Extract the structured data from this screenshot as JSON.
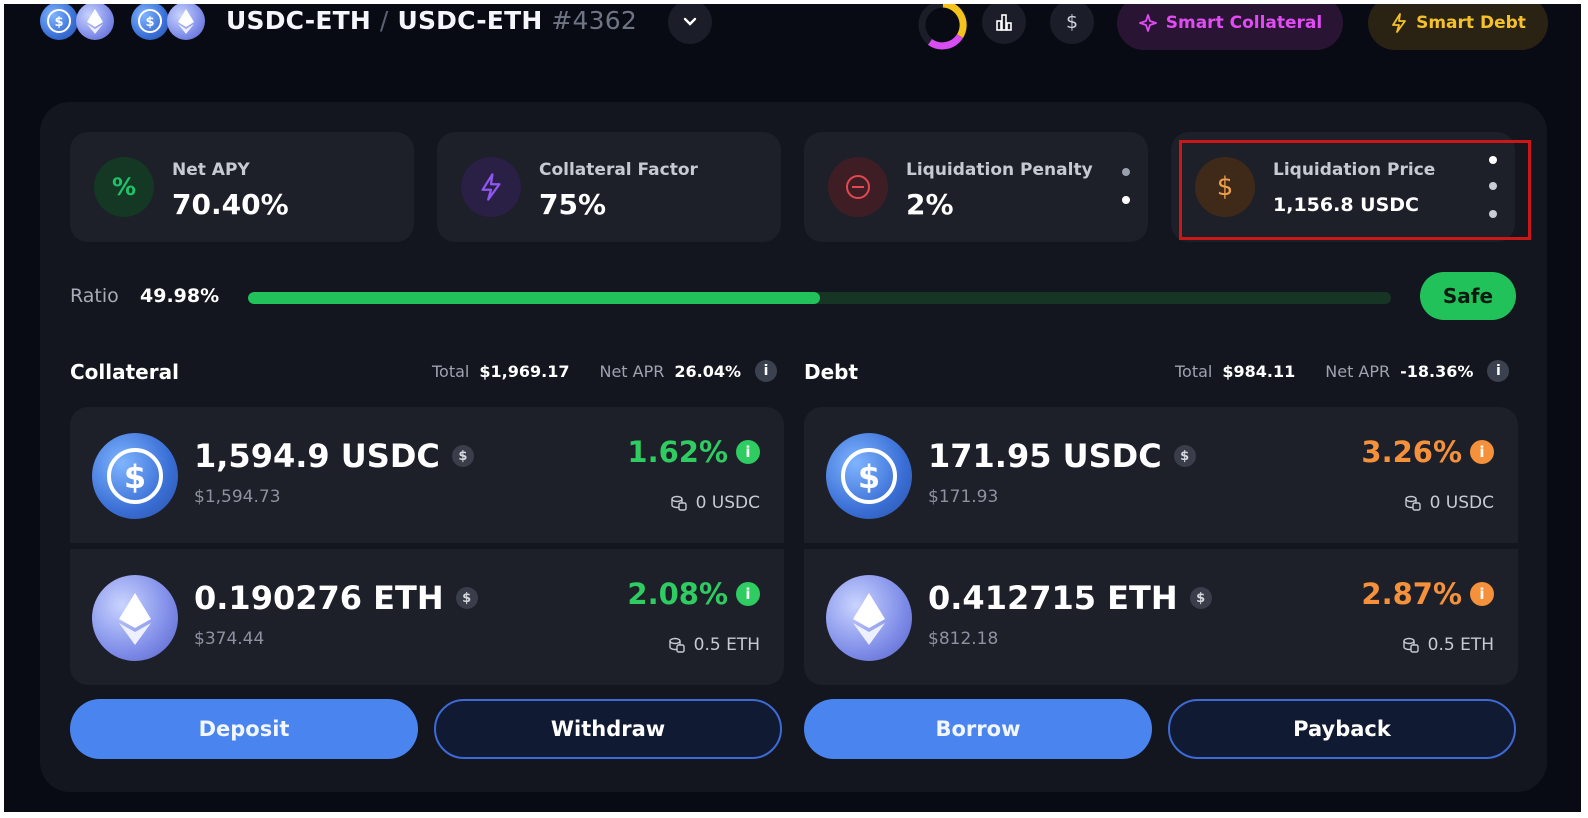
{
  "header": {
    "pair_left": "USDC-ETH",
    "separator": "/",
    "pair_right": "USDC-ETH",
    "position_id": "#4362",
    "icons": [
      "usdc-icon",
      "eth-icon",
      "chevron-down-icon",
      "ring-chart-icon",
      "bar-chart-icon",
      "dollar-icon",
      "sparkle-icon",
      "bolt-icon"
    ],
    "dollar_symbol": "$",
    "smart_collateral_label": "Smart Collateral",
    "smart_debt_label": "Smart Debt"
  },
  "stats": [
    {
      "label": "Net APY",
      "value": "70.40%",
      "icon": "percent-icon",
      "color": "#1ec26a"
    },
    {
      "label": "Collateral Factor",
      "value": "75%",
      "icon": "bolt-icon",
      "color": "#8f57f0"
    },
    {
      "label": "Liquidation Penalty",
      "value": "2%",
      "icon": "minus-circle-icon",
      "color": "#e3494f"
    },
    {
      "label": "Liquidation Price",
      "value": "1,156.8 USDC",
      "icon": "dollar-icon",
      "color": "#f0a04a"
    }
  ],
  "stat_glyphs": {
    "percent": "%",
    "dollar": "$"
  },
  "ratio": {
    "label": "Ratio",
    "value": "49.98%",
    "fill_fraction": 0.5,
    "status": "Safe"
  },
  "collateral": {
    "title": "Collateral",
    "total_label": "Total",
    "total": "$1,969.17",
    "apr_label": "Net APR",
    "apr": "26.04%",
    "assets": [
      {
        "amount": "1,594.9 USDC",
        "usd": "$1,594.73",
        "rate": "1.62%",
        "balance": "0 USDC",
        "coin": "usdc"
      },
      {
        "amount": "0.190276 ETH",
        "usd": "$374.44",
        "rate": "2.08%",
        "balance": "0.5 ETH",
        "coin": "eth"
      }
    ]
  },
  "debt": {
    "title": "Debt",
    "total_label": "Total",
    "total": "$984.11",
    "apr_label": "Net APR",
    "apr": "-18.36%",
    "assets": [
      {
        "amount": "171.95 USDC",
        "usd": "$171.93",
        "rate": "3.26%",
        "balance": "0 USDC",
        "coin": "usdc"
      },
      {
        "amount": "0.412715 ETH",
        "usd": "$812.18",
        "rate": "2.87%",
        "balance": "0.5 ETH",
        "coin": "eth"
      }
    ]
  },
  "glyphs": {
    "info": "i",
    "dollar": "$"
  },
  "buttons": {
    "deposit": "Deposit",
    "withdraw": "Withdraw",
    "borrow": "Borrow",
    "payback": "Payback"
  },
  "colors": {
    "background": "#080b14",
    "panel": "#14161f",
    "card": "#1d1f29",
    "positive": "#2ecc61",
    "negative": "#f5913a",
    "primary": "#4a84ef",
    "safe": "#22c25a",
    "highlight": "#cc1717"
  }
}
